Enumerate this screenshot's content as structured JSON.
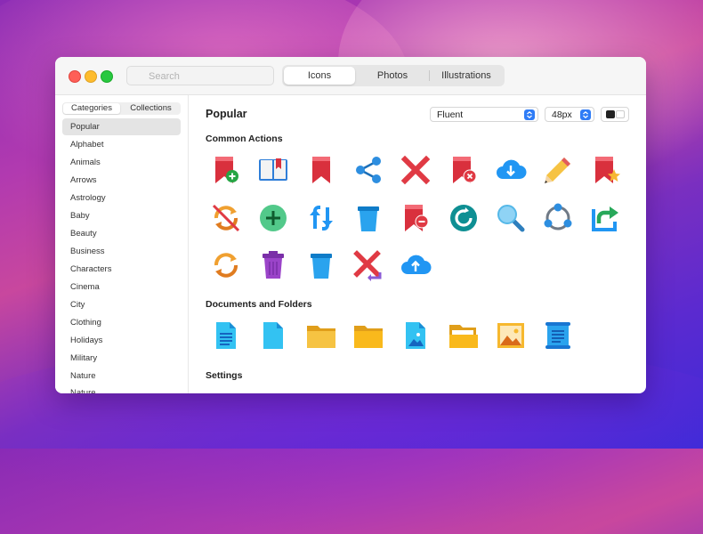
{
  "window": {
    "search_placeholder": "Search",
    "tabs": [
      {
        "label": "Icons",
        "active": true
      },
      {
        "label": "Photos",
        "active": false
      },
      {
        "label": "Illustrations",
        "active": false
      }
    ]
  },
  "sidebar": {
    "tabs": [
      {
        "label": "Categories",
        "active": true
      },
      {
        "label": "Collections",
        "active": false
      }
    ],
    "items": [
      {
        "label": "Popular",
        "selected": true
      },
      {
        "label": "Alphabet"
      },
      {
        "label": "Animals"
      },
      {
        "label": "Arrows"
      },
      {
        "label": "Astrology"
      },
      {
        "label": "Baby"
      },
      {
        "label": "Beauty"
      },
      {
        "label": "Business"
      },
      {
        "label": "Characters"
      },
      {
        "label": "Cinema"
      },
      {
        "label": "City"
      },
      {
        "label": "Clothing"
      },
      {
        "label": "Holidays"
      },
      {
        "label": "Military"
      },
      {
        "label": "Nature"
      },
      {
        "label": "Nature"
      }
    ]
  },
  "main": {
    "title": "Popular",
    "style_select": "Fluent",
    "size_select": "48px",
    "sections": [
      {
        "title": "Common Actions",
        "icons": [
          "bookmark-add-icon",
          "book-icon",
          "bookmark-icon",
          "share-icon",
          "delete-x-icon",
          "bookmark-remove-icon",
          "cloud-download-icon",
          "pencil-icon",
          "bookmark-star-icon",
          "sync-disabled-icon",
          "add-circle-icon",
          "vertical-sync-icon",
          "trash-can-icon",
          "bookmark-minus-icon",
          "refresh-icon",
          "search-icon",
          "triangle-sync-icon",
          "share-arrow-icon",
          "sync-icon",
          "trash-purple-icon",
          "trash-blue-icon",
          "undo-delete-icon",
          "cloud-upload-icon"
        ]
      },
      {
        "title": "Documents and Folders",
        "icons": [
          "document-text-icon",
          "document-icon",
          "folder-icon",
          "folder-closed-icon",
          "image-file-icon",
          "open-folder-icon",
          "picture-icon",
          "scroll-icon"
        ]
      },
      {
        "title": "Settings",
        "icons": []
      }
    ]
  },
  "colors": {
    "accent": "#2f7cf6",
    "red": "#e03a44",
    "blue": "#2196f3",
    "folder": "#f6b82e"
  }
}
